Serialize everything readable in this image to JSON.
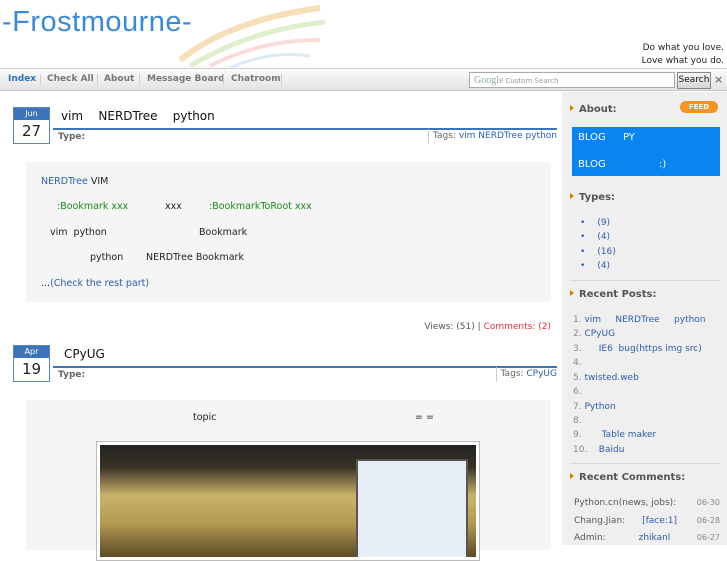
{
  "header": {
    "logo": "-Frostmourne-",
    "motto_line1": "Do what you love.",
    "motto_line2": "Love what you do."
  },
  "nav": {
    "tabs": [
      "Index",
      "Check All",
      "About",
      "Message Board",
      "Chatroom"
    ],
    "search_brand": "Google",
    "search_placeholder": "Custom Search",
    "search_button": "Search",
    "close_glyph": "×"
  },
  "posts": [
    {
      "month": "Jun",
      "day": "27",
      "title": "vim    NERDTree    python",
      "type_label": "Type:",
      "tags_label": "Tags:",
      "tags": [
        "vim",
        "NERDTree",
        "python"
      ],
      "body": {
        "line1_link": "NERDTree",
        "line1_text": " VIM",
        "line2_a": ":Bookmark xxx",
        "line2_b": "xxx",
        "line2_c": ":BookmarkToRoot xxx",
        "line3_a": "vim  python",
        "line3_b": "Bookmark",
        "line4_a": "python",
        "line4_b": "NERDTree Bookmark",
        "more_prefix": "...",
        "more_link": "(Check the rest part)"
      },
      "views": "Views: (51)",
      "sep": "|",
      "comments": "Comments: (2)"
    },
    {
      "month": "Apr",
      "day": "19",
      "title": "CPyUG",
      "type_label": "Type:",
      "tags_label": "Tags:",
      "tags": [
        "CPyUG"
      ],
      "body": {
        "topic": "topic",
        "emoticon": "= ="
      }
    }
  ],
  "sidebar": {
    "about_title": "About:",
    "feed_label": "FEED",
    "about_line1_a": "BLOG",
    "about_line1_b": "PY",
    "about_line2_a": "BLOG",
    "about_line2_b": ":)",
    "types_title": "Types:",
    "types": [
      {
        "bullet": "•",
        "count": "(9)"
      },
      {
        "bullet": "•",
        "count": "(4)"
      },
      {
        "bullet": "•",
        "count": "(16)"
      },
      {
        "bullet": "•",
        "count": "(4)"
      }
    ],
    "recent_posts_title": "Recent Posts:",
    "recent_posts": [
      {
        "num": "1.",
        "text": "vim     NERDTree     python"
      },
      {
        "num": "2.",
        "text": "CPyUG"
      },
      {
        "num": "3.",
        "text": "     IE6  bug(https img src)"
      },
      {
        "num": "4.",
        "text": ""
      },
      {
        "num": "5.",
        "text": "twisted.web"
      },
      {
        "num": "6.",
        "text": ""
      },
      {
        "num": "7.",
        "text": "Python"
      },
      {
        "num": "8.",
        "text": ""
      },
      {
        "num": "9.",
        "text": "      Table maker"
      },
      {
        "num": "10.",
        "text": "   Baidu"
      }
    ],
    "recent_comments_title": "Recent Comments:",
    "recent_comments": [
      {
        "author": "Python.cn(news, jobs):",
        "text": "",
        "date": "06-30"
      },
      {
        "author": "Chang.Jian:",
        "text": "[face:1]",
        "date": "06-28"
      },
      {
        "author": "Admin:",
        "text": "zhikanl",
        "date": "06-27"
      }
    ]
  }
}
